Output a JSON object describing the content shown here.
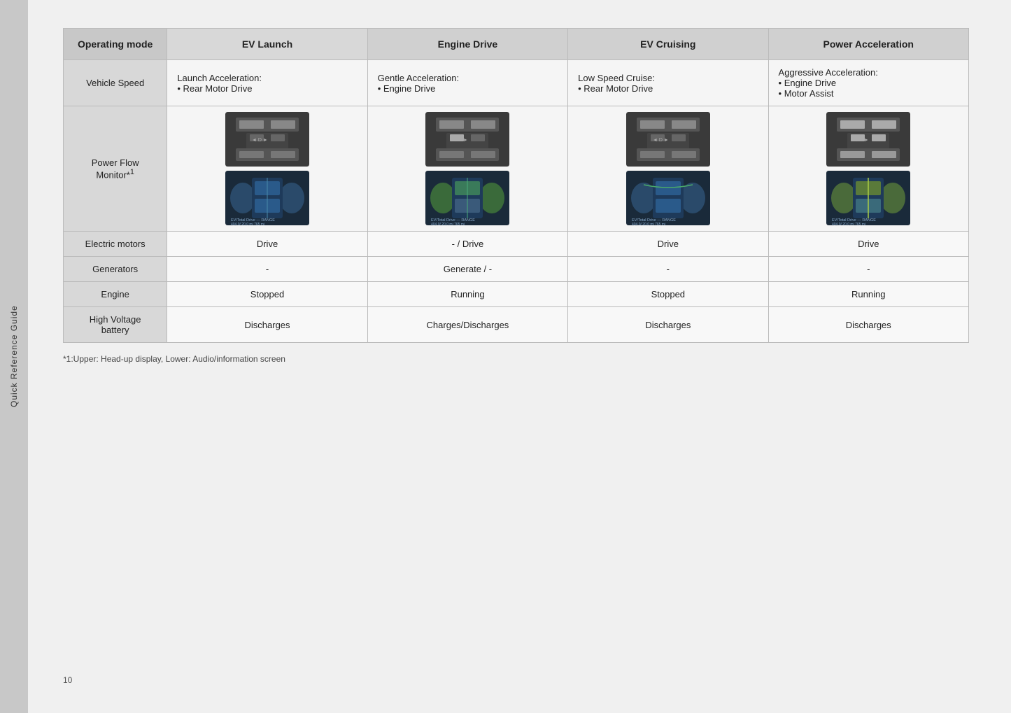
{
  "sidebar": {
    "label": "Quick Reference Guide"
  },
  "page_number": "10",
  "footnote": "*1:Upper: Head-up display, Lower: Audio/information screen",
  "table": {
    "header": {
      "col0": "Operating mode",
      "col1": "EV Launch",
      "col2": "Engine Drive",
      "col3": "EV Cruising",
      "col4": "Power Acceleration"
    },
    "rows": [
      {
        "label": "Vehicle Speed",
        "cells": [
          "Launch Acceleration:\n• Rear Motor Drive",
          "Gentle Acceleration:\n• Engine Drive",
          "Low Speed Cruise:\n• Rear Motor Drive",
          "Aggressive Acceleration:\n• Engine Drive\n• Motor Assist"
        ]
      },
      {
        "label": "Power Flow Monitor*1",
        "cells": [
          "images",
          "images",
          "images",
          "images"
        ]
      },
      {
        "label": "Electric motors",
        "cells": [
          "Drive",
          "- /  Drive",
          "Drive",
          "Drive"
        ]
      },
      {
        "label": "Generators",
        "cells": [
          "-",
          "Generate  /  -",
          "-",
          "-"
        ]
      },
      {
        "label": "Engine",
        "cells": [
          "Stopped",
          "Running",
          "Stopped",
          "Running"
        ]
      },
      {
        "label": "High Voltage battery",
        "cells": [
          "Discharges",
          "Charges/Discharges",
          "Discharges",
          "Discharges"
        ]
      }
    ]
  }
}
